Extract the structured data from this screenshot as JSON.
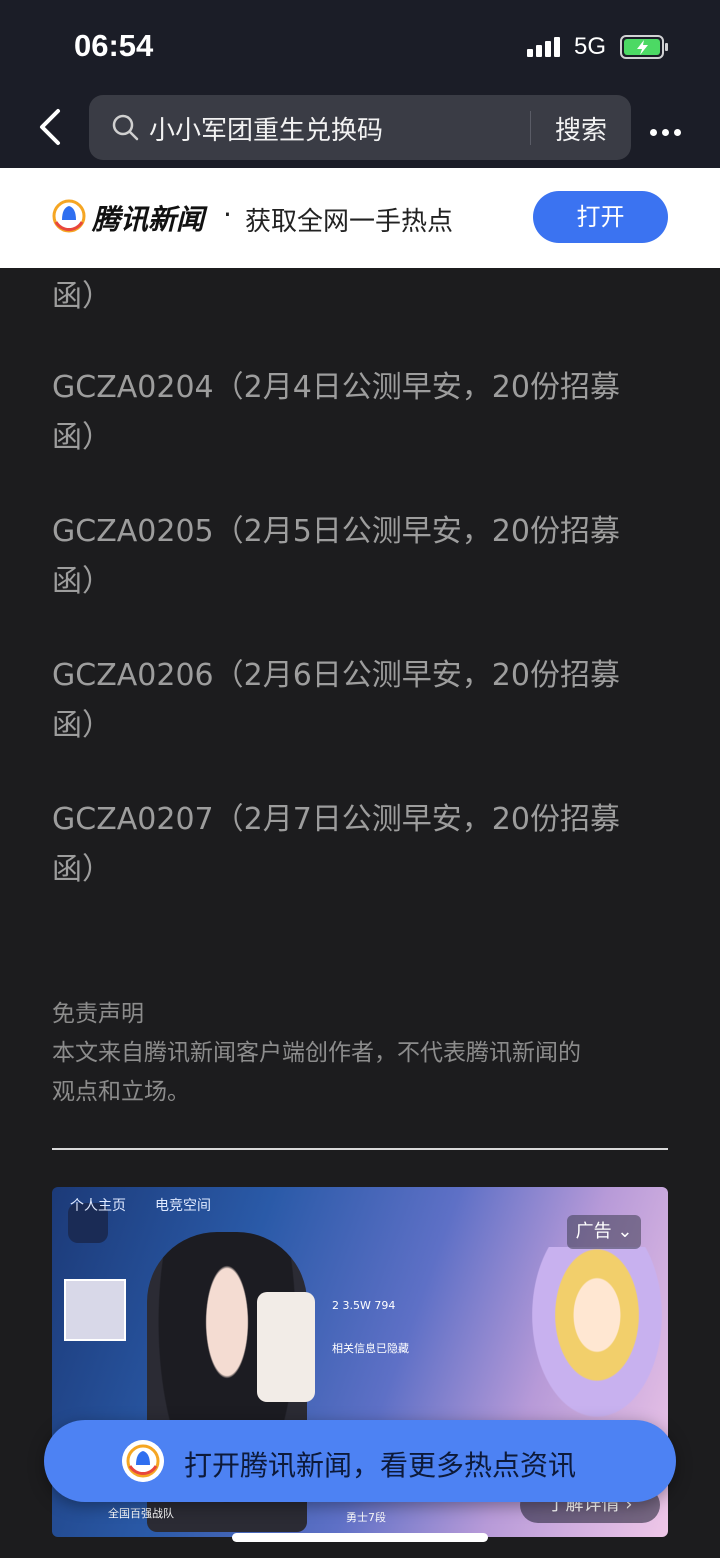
{
  "status_bar": {
    "time": "06:54",
    "network": "5G"
  },
  "search": {
    "query": "小小军团重生兑换码",
    "submit_label": "搜索"
  },
  "banner": {
    "brand": "腾讯新闻",
    "dot": "·",
    "tagline": "获取全网一手热点",
    "open_label": "打开"
  },
  "article": {
    "lines": [
      "函）",
      "GCZA0204（2月4日公测早安，20份招募",
      "函）",
      "GCZA0205（2月5日公测早安，20份招募",
      "函）",
      "GCZA0206（2月6日公测早安，20份招募",
      "函）",
      "GCZA0207（2月7日公测早安，20份招募",
      "函）"
    ]
  },
  "disclaimer": {
    "title": "免责声明",
    "line1": "本文来自腾讯新闻客户端创作者，不代表腾讯新闻的",
    "line2": "观点和立场。"
  },
  "ad": {
    "tab1": "个人主页",
    "tab2": "电竞空间",
    "label": "广告",
    "stats": "2   3.5W   794",
    "stat_note": "相关信息已隐藏",
    "bottom_left": "全国百强战队",
    "bottom_mid": "勇士7段",
    "detail_label": "了解详情"
  },
  "float_cta": {
    "text": "打开腾讯新闻，看更多热点资讯"
  },
  "colors": {
    "accent": "#3b73f1",
    "cta": "#4d82f3",
    "background": "#1c1c1e"
  },
  "icons": [
    "back-arrow-icon",
    "search-icon",
    "more-icon",
    "tencent-news-logo-icon",
    "chevron-down-icon"
  ]
}
